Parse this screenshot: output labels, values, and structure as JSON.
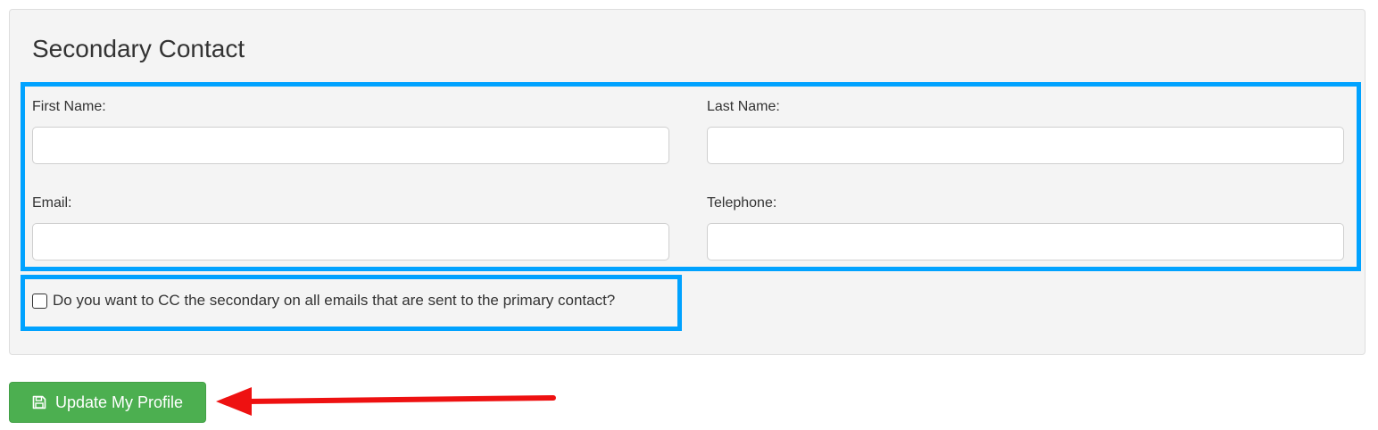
{
  "section": {
    "title": "Secondary Contact"
  },
  "fields": {
    "first_name": {
      "label": "First Name:",
      "value": "",
      "placeholder": ""
    },
    "last_name": {
      "label": "Last Name:",
      "value": "",
      "placeholder": ""
    },
    "email": {
      "label": "Email:",
      "value": "",
      "placeholder": ""
    },
    "telephone": {
      "label": "Telephone:",
      "value": "",
      "placeholder": ""
    }
  },
  "cc_option": {
    "label": "Do you want to CC the secondary on all emails that are sent to the primary contact?",
    "checked": false
  },
  "actions": {
    "update_label": "Update My Profile",
    "update_icon": "save-icon"
  },
  "colors": {
    "highlight": "#00a2ff",
    "button": "#4caf50",
    "arrow": "#ee1111"
  }
}
